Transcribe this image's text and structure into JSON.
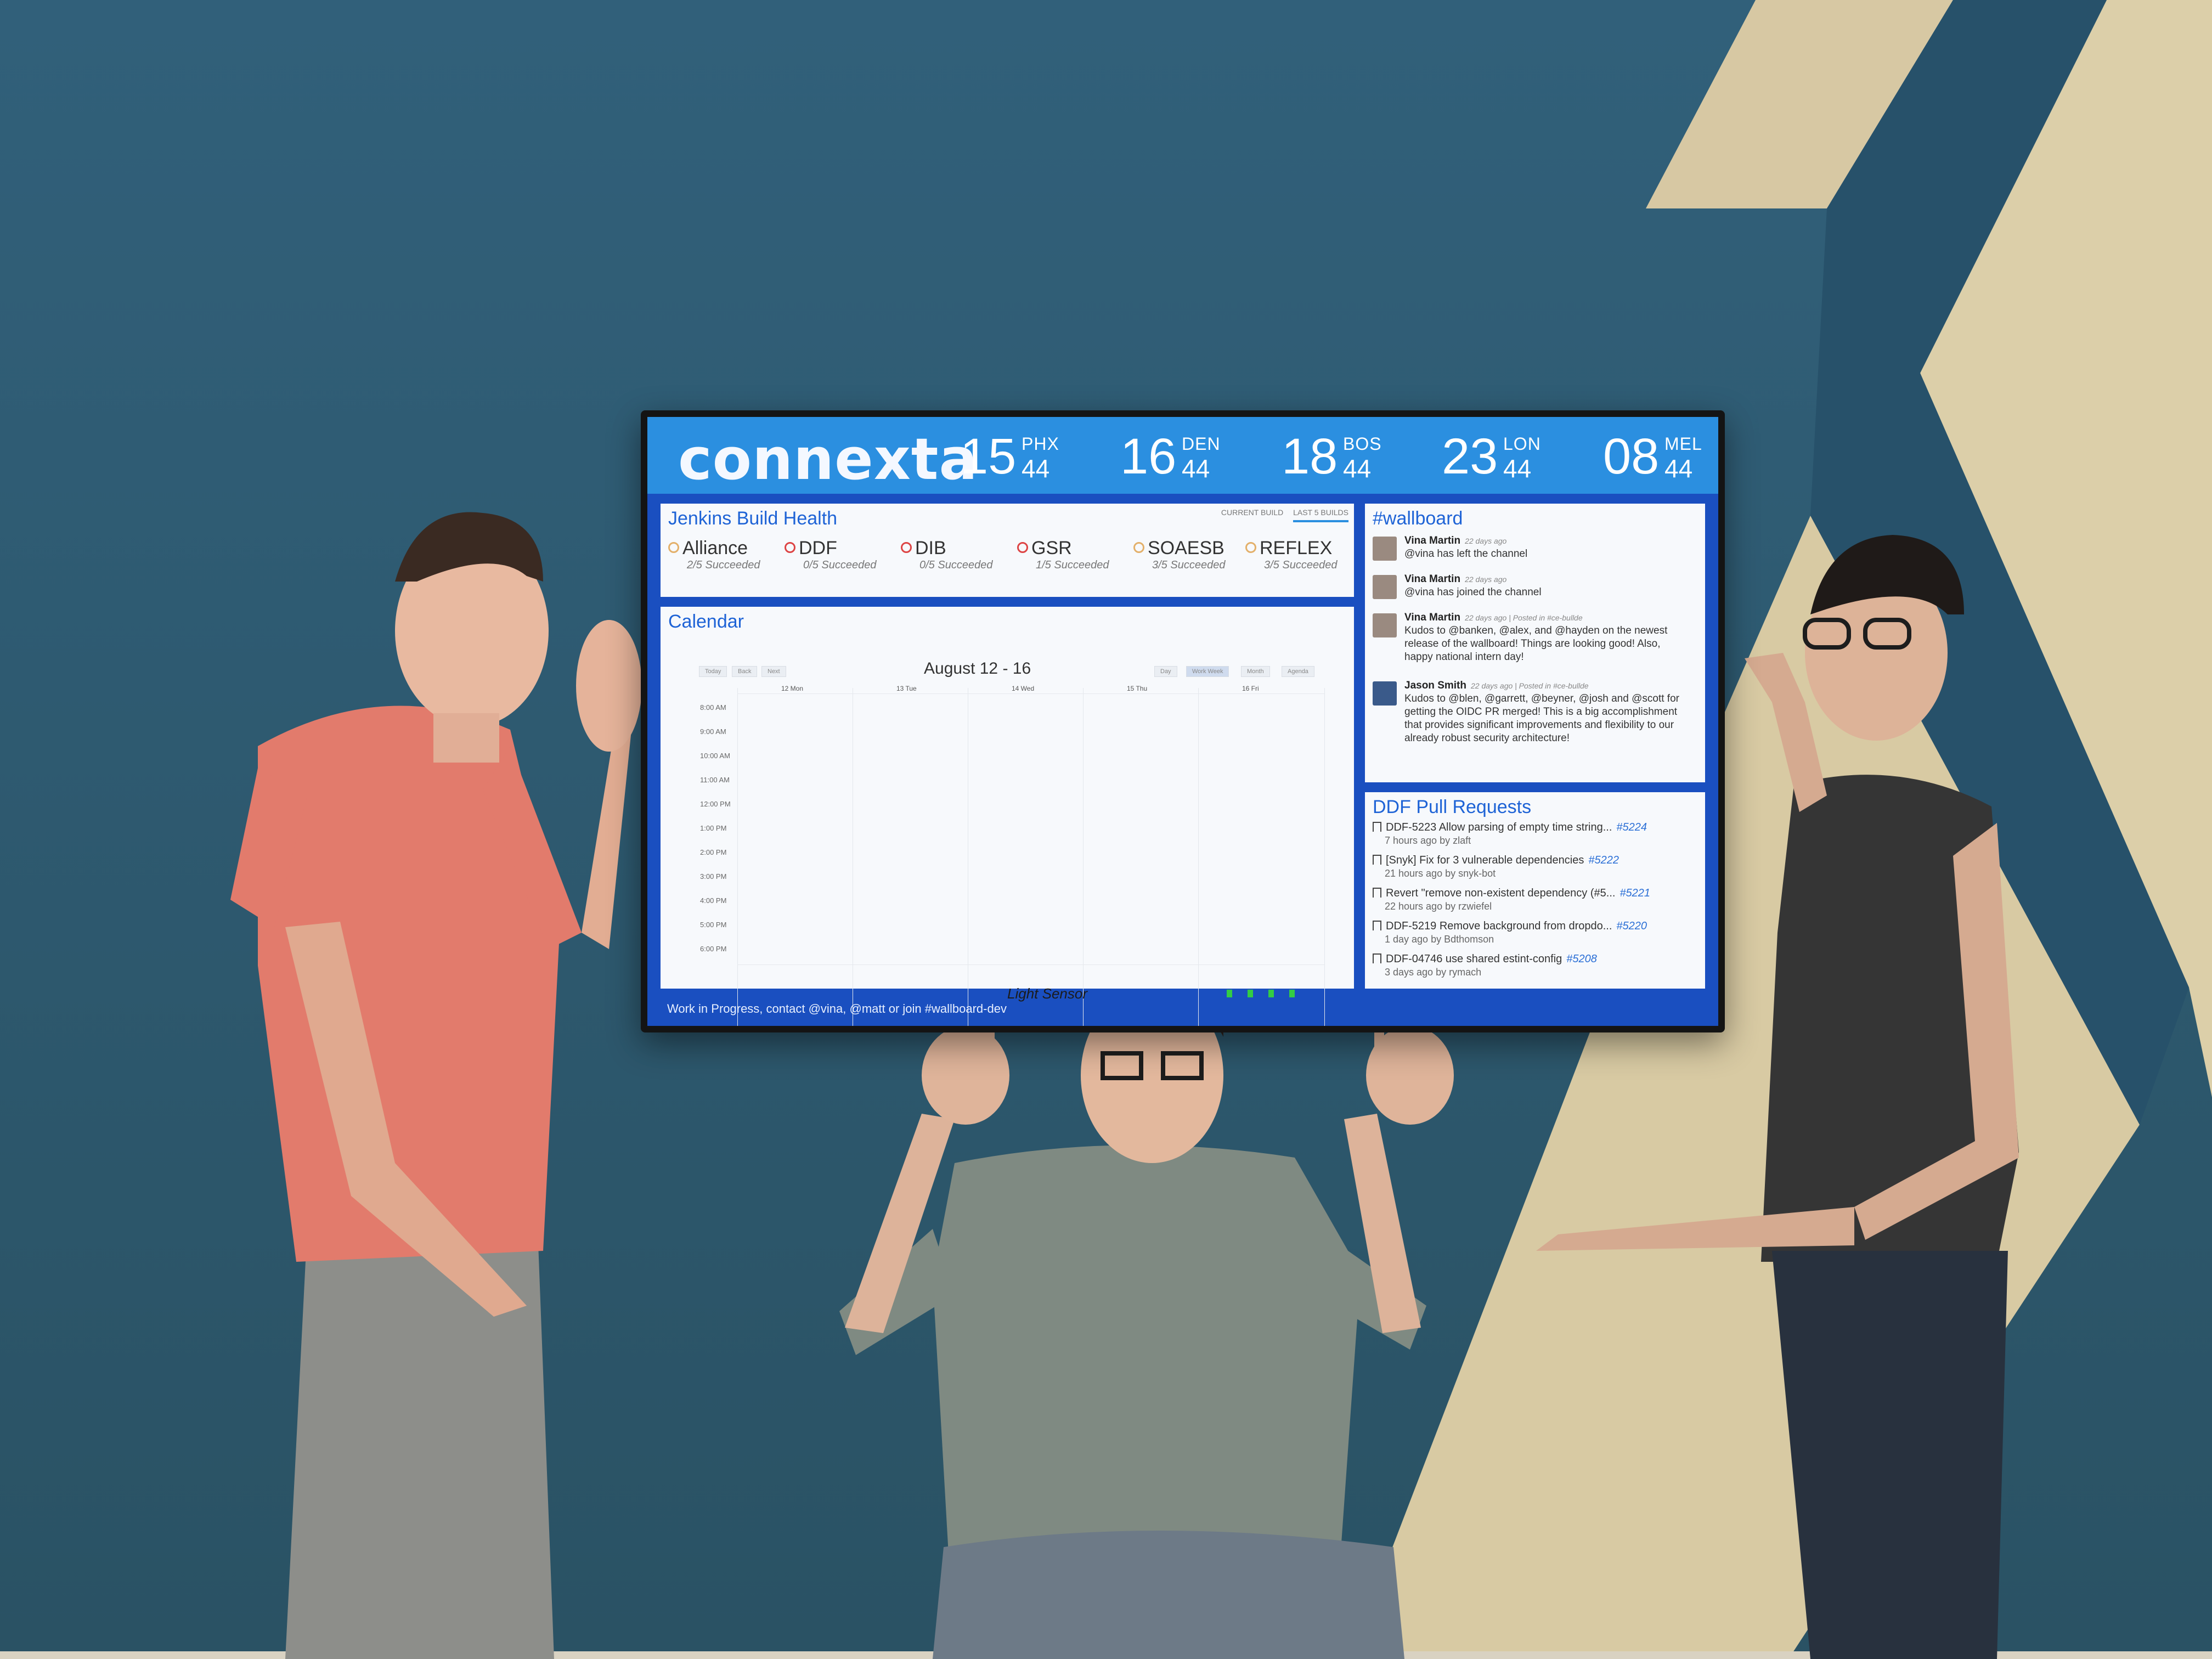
{
  "brand": {
    "logo_text": "connexta"
  },
  "clocks": [
    {
      "hour": "15",
      "minute": "44",
      "city": "PHX"
    },
    {
      "hour": "16",
      "minute": "44",
      "city": "DEN"
    },
    {
      "hour": "18",
      "minute": "44",
      "city": "BOS"
    },
    {
      "hour": "23",
      "minute": "44",
      "city": "LON"
    },
    {
      "hour": "08",
      "minute": "44",
      "city": "MEL"
    }
  ],
  "jenkins": {
    "title": "Jenkins Build Health",
    "tabs": [
      "CURRENT BUILD",
      "LAST 5 BUILDS"
    ],
    "active_tab": "LAST 5 BUILDS",
    "jobs": [
      {
        "name": "Alliance",
        "status": "2/5 Succeeded",
        "state": "partial"
      },
      {
        "name": "DDF",
        "status": "0/5 Succeeded",
        "state": "failed"
      },
      {
        "name": "DIB",
        "status": "0/5 Succeeded",
        "state": "failed"
      },
      {
        "name": "GSR",
        "status": "1/5 Succeeded",
        "state": "failed"
      },
      {
        "name": "SOAESB",
        "status": "3/5 Succeeded",
        "state": "partial"
      },
      {
        "name": "REFLEX",
        "status": "3/5 Succeeded",
        "state": "partial"
      }
    ]
  },
  "calendar": {
    "title": "Calendar",
    "week_label": "August 12 - 16",
    "days": [
      "12 Mon",
      "13 Tue",
      "14 Wed",
      "15 Thu",
      "16 Fri"
    ],
    "times": [
      "8:00 AM",
      "9:00 AM",
      "10:00 AM",
      "11:00 AM",
      "12:00 PM",
      "1:00 PM",
      "2:00 PM",
      "3:00 PM",
      "4:00 PM",
      "5:00 PM",
      "6:00 PM"
    ],
    "nav_buttons": [
      "Today",
      "Back",
      "Next"
    ],
    "view_buttons": [
      "Day",
      "Work Week",
      "Month",
      "Agenda"
    ],
    "active_view": "Work Week"
  },
  "wallboard": {
    "title": "#wallboard",
    "messages": [
      {
        "author": "Vina Martin",
        "time": "22 days ago",
        "text": "@vina has left the channel"
      },
      {
        "author": "Vina Martin",
        "time": "22 days ago",
        "text": "@vina has joined the channel"
      },
      {
        "author": "Vina Martin",
        "time": "22 days ago | Posted in #ce-bullde",
        "text": "Kudos to @banken, @alex, and @hayden on the newest release of the wallboard! Things are looking good! Also, happy national intern day!"
      },
      {
        "author": "Jason Smith",
        "time": "22 days ago | Posted in #ce-bullde",
        "text": "Kudos to @blen, @garrett, @beyner, @josh and @scott for getting the OIDC PR merged! This is a big accomplishment that provides significant improvements and flexibility to our already robust security architecture!"
      }
    ]
  },
  "pull_requests": {
    "title": "DDF Pull Requests",
    "items": [
      {
        "title": "DDF-5223 Allow parsing of empty time string...",
        "number": "#5224",
        "meta": "7 hours ago by zlaft"
      },
      {
        "title": "[Snyk] Fix for 3 vulnerable dependencies",
        "number": "#5222",
        "meta": "21 hours ago by snyk-bot"
      },
      {
        "title": "Revert \"remove non-existent dependency (#5...",
        "number": "#5221",
        "meta": "22 hours ago by rzwiefel"
      },
      {
        "title": "DDF-5219 Remove background from dropdo...",
        "number": "#5220",
        "meta": "1 day ago by Bdthomson"
      },
      {
        "title": "DDF-04746 use shared estint-config",
        "number": "#5208",
        "meta": "3 days ago by rymach"
      }
    ]
  },
  "footer": {
    "text": "Work in Progress, contact @vina, @matt or join #wallboard-dev"
  },
  "ambient_label": "Light Sensor",
  "colors": {
    "wall": "#2f5a6c",
    "header": "#2b8fe0",
    "screen_frame": "#1a4fc0",
    "accent_text": "#1e63d6",
    "wall_stripe": "#d8cba6"
  }
}
